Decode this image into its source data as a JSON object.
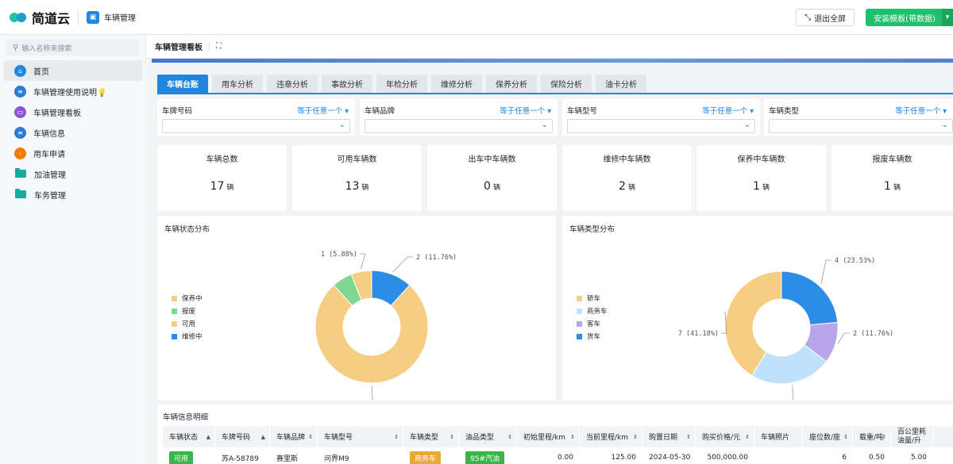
{
  "topbar": {
    "brand": "简道云",
    "app_name": "车辆管理",
    "exit_fullscreen": "退出全屏",
    "install_template": "安装模板(带数据)"
  },
  "sidebar": {
    "search_placeholder": "输入名称来搜索",
    "items": [
      {
        "label": "首页",
        "icon": "home-icon",
        "color": "#1e88e5"
      },
      {
        "label": "车辆管理使用说明💡",
        "icon": "doc-icon",
        "color": "#2b7bd8"
      },
      {
        "label": "车辆管理看板",
        "icon": "dashboard-icon",
        "color": "#8e55d8"
      },
      {
        "label": "车辆信息",
        "icon": "form-icon",
        "color": "#2b7bd8"
      },
      {
        "label": "用车申请",
        "icon": "flow-icon",
        "color": "#f57c00"
      },
      {
        "label": "加油管理",
        "icon": "folder-icon",
        "color": "#18a9a0"
      },
      {
        "label": "车务管理",
        "icon": "folder-icon",
        "color": "#18a9a0"
      }
    ]
  },
  "dashboard": {
    "title": "车辆管理看板",
    "fullscreen_icon": "expand-icon"
  },
  "tabs": [
    "车辆台账",
    "用车分析",
    "违章分析",
    "事故分析",
    "年检分析",
    "维修分析",
    "保养分析",
    "保险分析",
    "油卡分析"
  ],
  "filters": [
    {
      "label": "车牌号码",
      "operator": "等于任意一个 ▾"
    },
    {
      "label": "车辆品牌",
      "operator": "等于任意一个 ▾"
    },
    {
      "label": "车辆型号",
      "operator": "等于任意一个 ▾"
    },
    {
      "label": "车辆类型",
      "operator": "等于任意一个 ▾"
    }
  ],
  "stats": [
    {
      "label": "车辆总数",
      "value": "17",
      "unit": "辆"
    },
    {
      "label": "可用车辆数",
      "value": "13",
      "unit": "辆"
    },
    {
      "label": "出车中车辆数",
      "value": "0",
      "unit": "辆"
    },
    {
      "label": "维修中车辆数",
      "value": "2",
      "unit": "辆"
    },
    {
      "label": "保养中车辆数",
      "value": "1",
      "unit": "辆"
    },
    {
      "label": "报废车辆数",
      "value": "1",
      "unit": "辆"
    }
  ],
  "charts": {
    "status_title": "车辆状态分布",
    "type_title": "车辆类型分布"
  },
  "chart_data": [
    {
      "type": "pie",
      "title": "车辆状态分布",
      "legend": [
        "保养中",
        "报废",
        "可用",
        "维修中"
      ],
      "slices": [
        {
          "name": "维修中",
          "value": 2,
          "label": "2 (11.76%)",
          "color": "#2b8de8"
        },
        {
          "name": "可用",
          "value": 13,
          "label": "13 (76.47%)",
          "color": "#f7cd84"
        },
        {
          "name": "报废",
          "value": 1,
          "label": "",
          "color": "#7fd88f"
        },
        {
          "name": "保养中",
          "value": 1,
          "label": "1 (5.88%)",
          "color": "#f7cd84"
        }
      ]
    },
    {
      "type": "pie",
      "title": "车辆类型分布",
      "legend": [
        "轿车",
        "商务车",
        "客车",
        "货车"
      ],
      "slices": [
        {
          "name": "货车",
          "value": 4,
          "label": "4 (23.53%)",
          "color": "#2b8de8"
        },
        {
          "name": "客车",
          "value": 2,
          "label": "2 (11.76%)",
          "color": "#b7a6ea"
        },
        {
          "name": "商务车",
          "value": 4,
          "label": "4 (23.53%)",
          "color": "#bfe1fb"
        },
        {
          "name": "轿车",
          "value": 7,
          "label": "7 (41.18%)",
          "color": "#f7cd84"
        }
      ]
    }
  ],
  "legend_colors": {
    "保养中": "#f7cd84",
    "报废": "#7fd88f",
    "可用": "#f7cd84",
    "维修中": "#2b8de8",
    "轿车": "#f7cd84",
    "商务车": "#bfe1fb",
    "客车": "#b7a6ea",
    "货车": "#2b8de8"
  },
  "table": {
    "title": "车辆信息明细",
    "headers": [
      "车辆状态",
      "车牌号码",
      "车辆品牌",
      "车辆型号",
      "车辆类型",
      "油品类型",
      "初始里程/km",
      "当前里程/km",
      "购置日期",
      "购买价格/元",
      "车辆照片",
      "座位数/座",
      "载重/吨",
      "百公里耗油量/升"
    ],
    "row": [
      "可用",
      "苏A-58789",
      "赛里斯",
      "问界M9",
      "商务车",
      "95#汽油",
      "0.00",
      "125.00",
      "2024-05-30",
      "500,000.00",
      "",
      "6",
      "0.50",
      "5.00"
    ]
  }
}
